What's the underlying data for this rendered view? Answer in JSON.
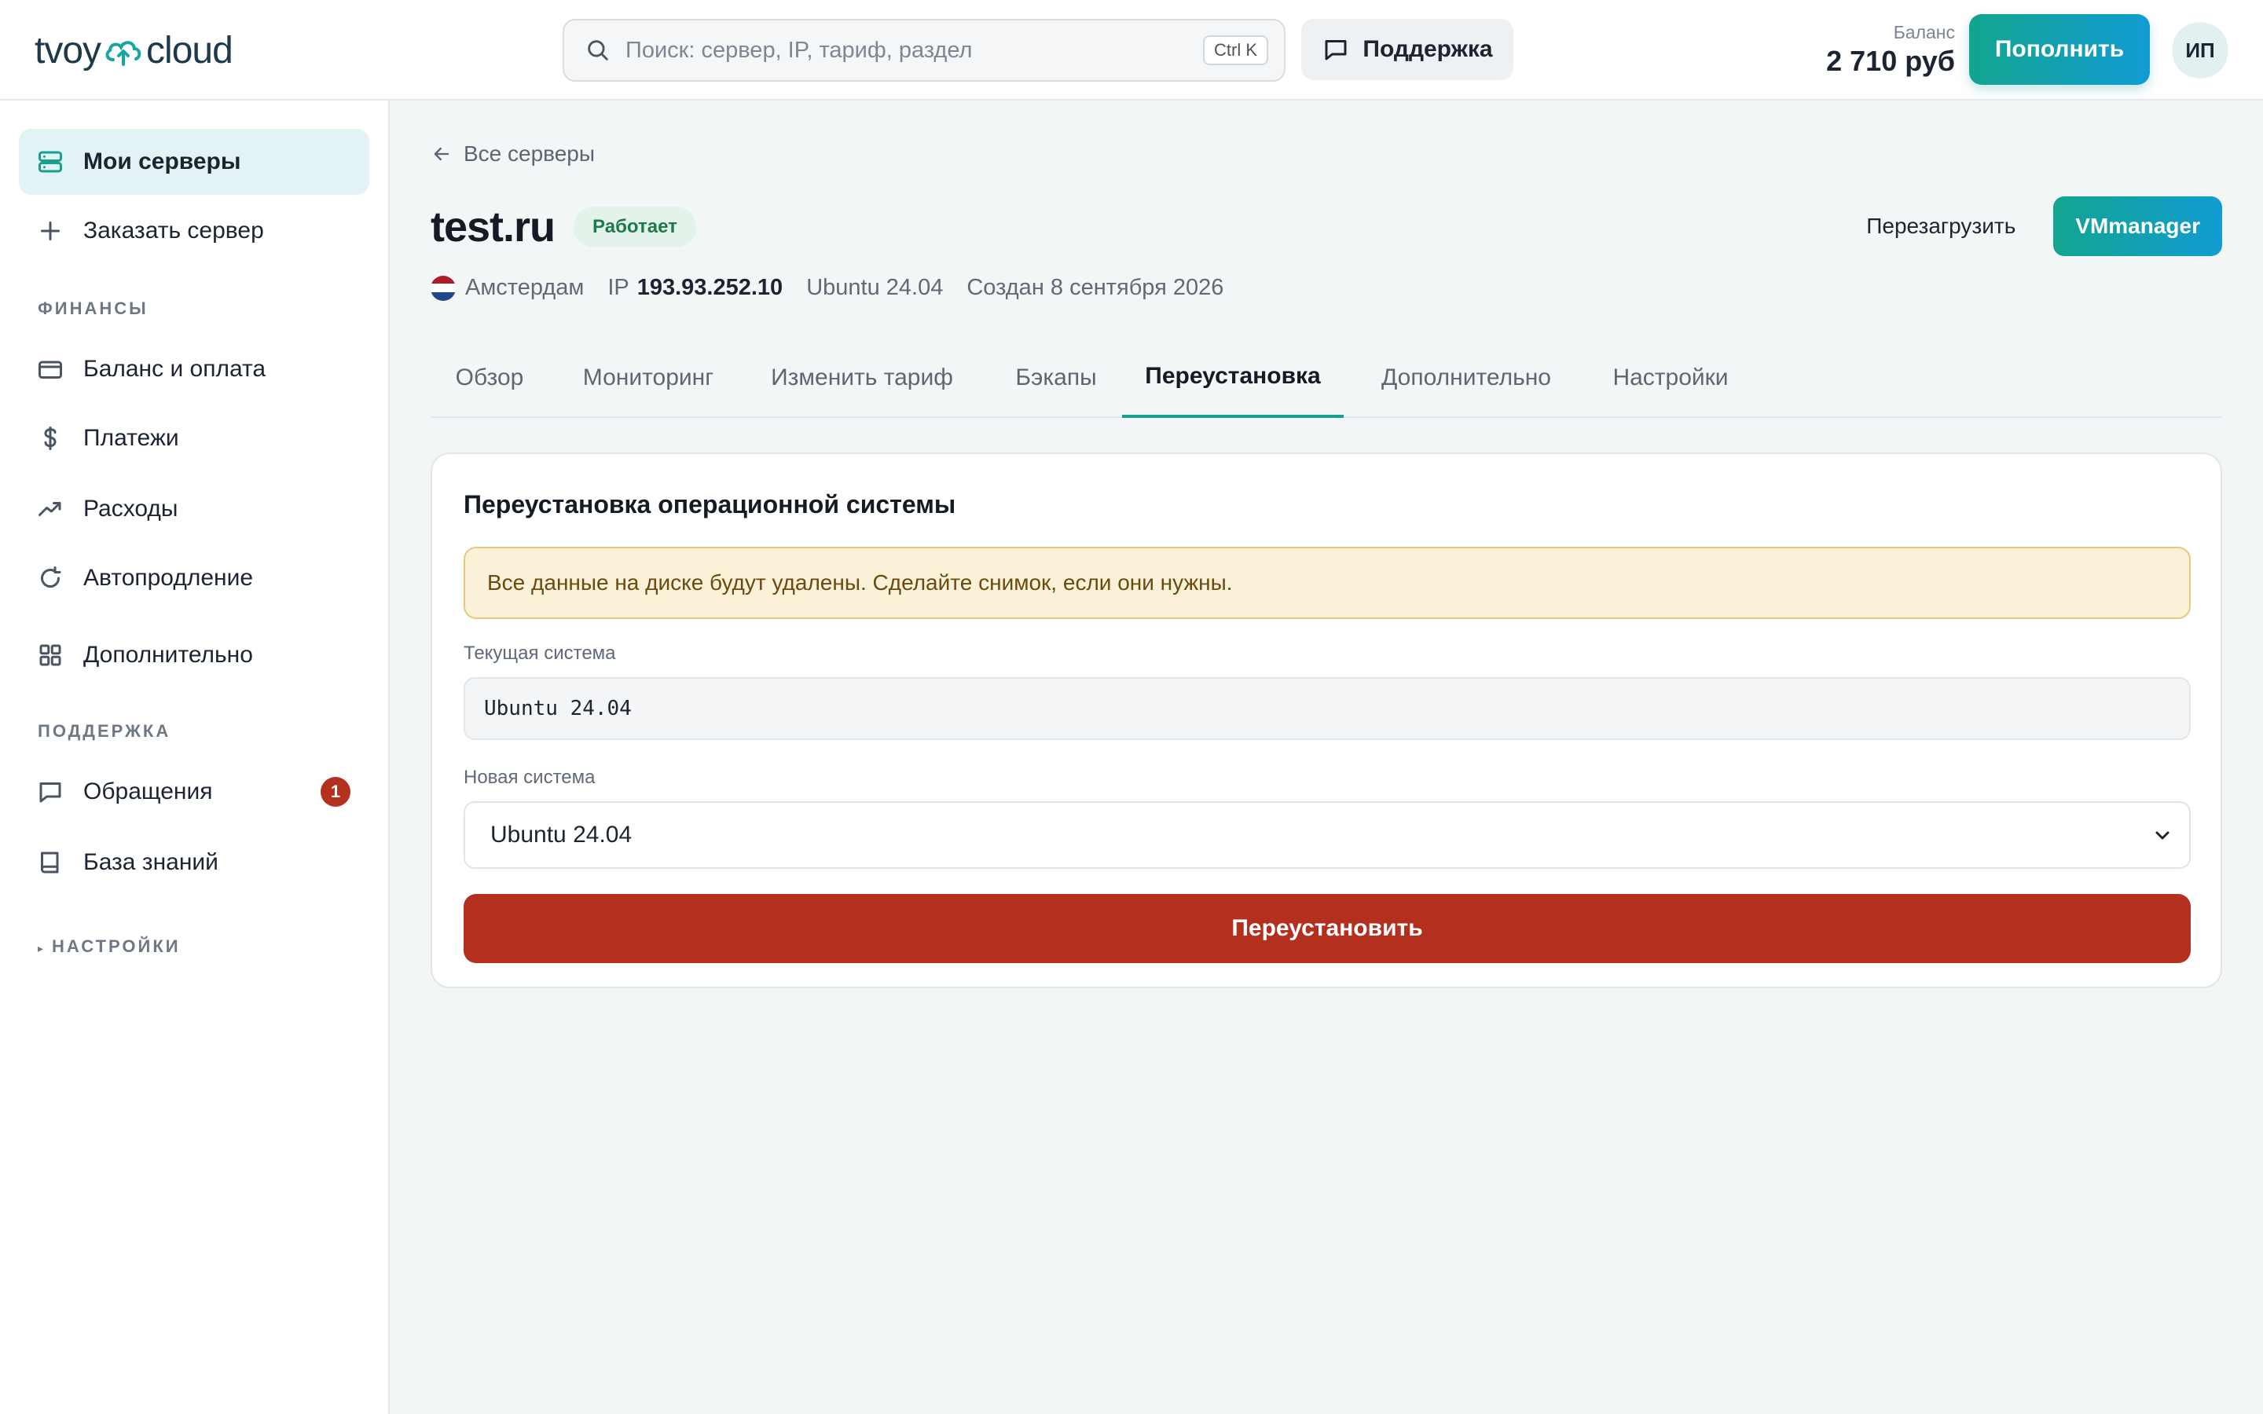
{
  "header": {
    "logo_left": "tvoy",
    "logo_right": "cloud",
    "search_placeholder": "Поиск: сервер, IP, тариф, раздел",
    "search_shortcut": "Ctrl K",
    "support_label": "Поддержка",
    "balance_label": "Баланс",
    "balance_value": "2 710 руб",
    "topup_label": "Пополнить",
    "avatar_initials": "ИП"
  },
  "sidebar": {
    "items_top": [
      {
        "label": "Мои серверы",
        "icon": "server-icon",
        "active": true
      },
      {
        "label": "Заказать сервер",
        "icon": "plus-icon",
        "active": false
      }
    ],
    "section_finance": "ФИНАНСЫ",
    "finance_items": [
      {
        "label": "Баланс и оплата",
        "icon": "credit-card-icon"
      },
      {
        "label": "Платежи",
        "icon": "dollar-icon"
      },
      {
        "label": "Расходы",
        "icon": "trend-up-icon"
      },
      {
        "label": "Автопродление",
        "icon": "refresh-icon"
      },
      {
        "label": "Дополнительно",
        "icon": "grid-icon"
      }
    ],
    "section_support": "ПОДДЕРЖКА",
    "support_items": [
      {
        "label": "Обращения",
        "icon": "chat-icon",
        "badge": "1"
      },
      {
        "label": "База знаний",
        "icon": "book-icon"
      }
    ],
    "section_settings": "НАСТРОЙКИ",
    "settings_marker": "▸"
  },
  "server": {
    "back_label": "Все серверы",
    "name": "test.ru",
    "status": "Работает",
    "reboot_label": "Перезагрузить",
    "vmmanager_label": "VMmanager",
    "location": "Амстердам",
    "ip_label": "IP",
    "ip_value": "193.93.252.10",
    "os": "Ubuntu 24.04",
    "created": "Создан 8 сентября 2026"
  },
  "tabs": [
    "Обзор",
    "Мониторинг",
    "Изменить тариф",
    "Бэкапы",
    "Переустановка",
    "Дополнительно",
    "Настройки"
  ],
  "active_tab": "Переустановка",
  "reinstall": {
    "title": "Переустановка операционной системы",
    "warning": "Все данные на диске будут удалены. Сделайте снимок, если они нужны.",
    "current_label": "Текущая система",
    "current_value": "Ubuntu 24.04",
    "new_label": "Новая система",
    "new_value": "Ubuntu 24.04",
    "submit_label": "Переустановить"
  },
  "colors": {
    "accent_start": "#12a58f",
    "accent_end": "#129bd3",
    "danger": "#b3301f",
    "status_bg": "#e3f3ea",
    "status_text": "#1d7a4c",
    "warning_bg": "#fbf0d8",
    "warning_border": "#e6c97e"
  }
}
